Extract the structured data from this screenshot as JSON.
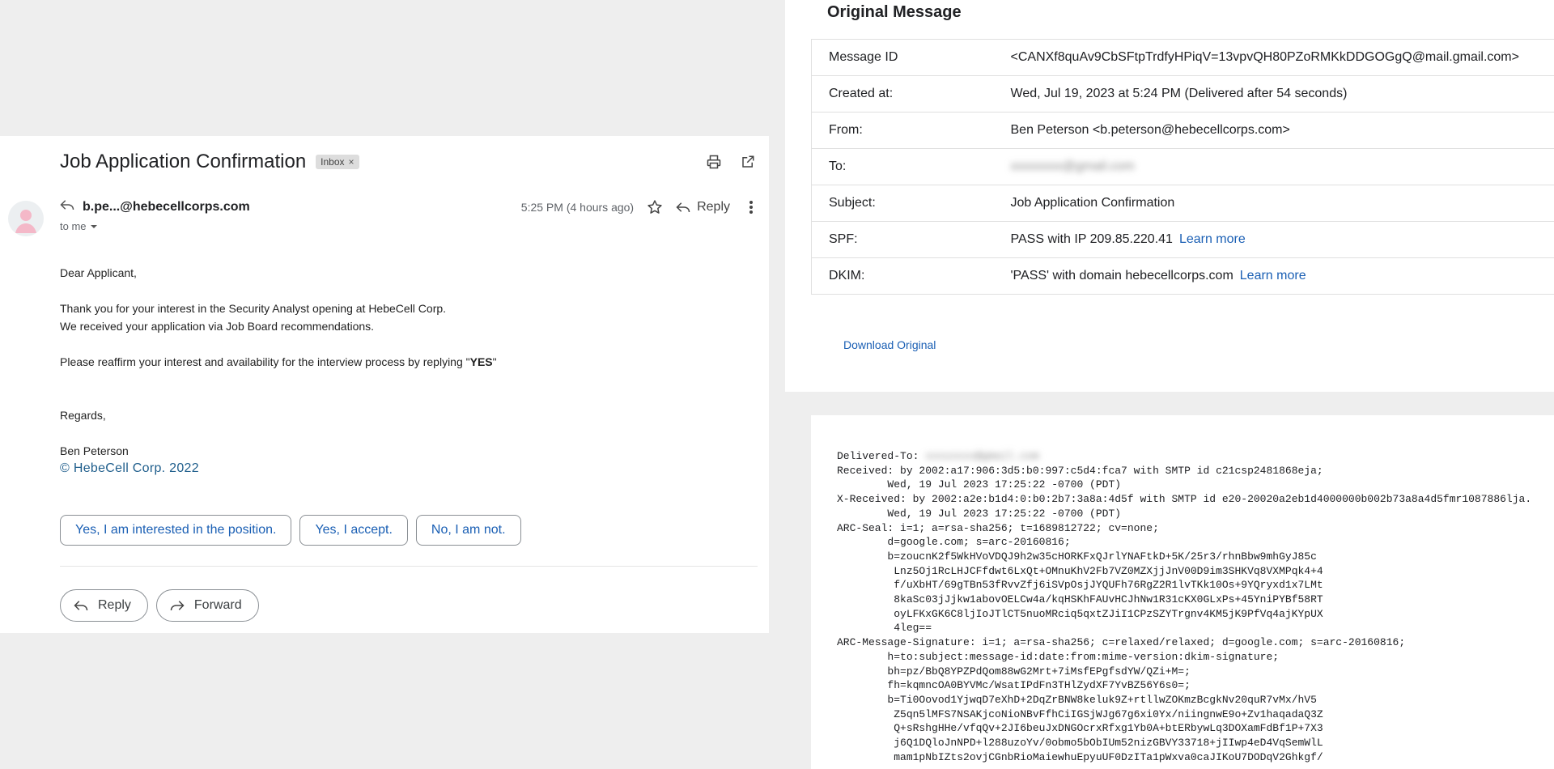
{
  "email": {
    "subject": "Job Application Confirmation",
    "label_chip": "Inbox",
    "label_chip_close": "×",
    "sender": "b.pe...@hebecellcorps.com",
    "to": "to me",
    "time": "5:25 PM (4 hours ago)",
    "reply_label": "Reply",
    "body": {
      "greeting": "Dear Applicant,",
      "line1": "Thank you for your interest in the Security Analyst opening at HebeCell Corp.",
      "line2": "We received your application via Job Board recommendations.",
      "line3_prefix": "Please reaffirm your interest and availability for the interview process by replying \"",
      "line3_bold": "YES",
      "line3_suffix": "\"",
      "regards": "Regards,",
      "signature_name": "Ben Peterson",
      "signature_copyright": "© HebeCell Corp. 2022"
    },
    "smart_replies": [
      "Yes, I am interested in the position.",
      "Yes, I accept.",
      "No, I am not."
    ],
    "actions": {
      "reply": "Reply",
      "forward": "Forward"
    }
  },
  "original": {
    "title": "Original Message",
    "rows": [
      {
        "label": "Message ID",
        "value": "<CANXf8quAv9CbSFtpTrdfyHPiqV=13vpvQH80PZoRMKkDDGOGgQ@mail.gmail.com>"
      },
      {
        "label": "Created at:",
        "value": "Wed, Jul 19, 2023 at 5:24 PM (Delivered after 54 seconds)"
      },
      {
        "label": "From:",
        "value": "Ben Peterson <b.peterson@hebecellcorps.com>"
      },
      {
        "label": "To:",
        "value": "xxxxxxxx@gmail.com"
      },
      {
        "label": "Subject:",
        "value": "Job Application Confirmation"
      },
      {
        "label": "SPF:",
        "value": "PASS with IP 209.85.220.41",
        "link": "Learn more"
      },
      {
        "label": "DKIM:",
        "value": "'PASS' with domain hebecellcorps.com",
        "link": "Learn more"
      }
    ],
    "download": "Download Original"
  },
  "raw_headers": {
    "delivered_to_label": "Delivered-To: ",
    "delivered_to_value": "xxxxxxxx@gmail.com",
    "lines": [
      "Received: by 2002:a17:906:3d5:b0:997:c5d4:fca7 with SMTP id c21csp2481868eja;",
      "        Wed, 19 Jul 2023 17:25:22 -0700 (PDT)",
      "X-Received: by 2002:a2e:b1d4:0:b0:2b7:3a8a:4d5f with SMTP id e20-20020a2eb1d4000000b002b73a8a4d5fmr1087886lja.",
      "        Wed, 19 Jul 2023 17:25:22 -0700 (PDT)",
      "ARC-Seal: i=1; a=rsa-sha256; t=1689812722; cv=none;",
      "        d=google.com; s=arc-20160816;",
      "        b=zoucnK2f5WkHVoVDQJ9h2w35cHORKFxQJrlYNAFtkD+5K/25r3/rhnBbw9mhGyJ85c",
      "         Lnz5Oj1RcLHJCFfdwt6LxQt+OMnuKhV2Fb7VZ0MZXjjJnV00D9im3SHKVq8VXMPqk4+4",
      "         f/uXbHT/69gTBn53fRvvZfj6iSVpOsjJYQUFh76RgZ2R1lvTKk10Os+9YQryxd1x7LMt",
      "         8kaSc03jJjkw1abovOELCw4a/kqHSKhFAUvHCJhNw1R31cKX0GLxPs+45YniPYBf58RT",
      "         oyLFKxGK6C8ljIoJTlCT5nuoMRciq5qxtZJiI1CPzSZYTrgnv4KM5jK9PfVq4ajKYpUX",
      "         4leg==",
      "ARC-Message-Signature: i=1; a=rsa-sha256; c=relaxed/relaxed; d=google.com; s=arc-20160816;",
      "        h=to:subject:message-id:date:from:mime-version:dkim-signature;",
      "        bh=pz/BbQ8YPZPdQom88wG2Mrt+7iMsfEPgfsdYW/QZi+M=;",
      "        fh=kqmncOA0BYVMc/WsatIPdFn3THlZydXF7YvBZ56Y6s0=;",
      "        b=Ti0Oovod1YjwqD7eXhD+2DqZrBNW8keluk9Z+rtllwZOKmzBcgkNv20quR7vMx/hV5",
      "         Z5qn5lMFS7NSAKjcoNioNBvFfhCiIGSjWJg67g6xi0Yx/niingnwE9o+Zv1haqadaQ3Z",
      "         Q+sRshgHHe/vfqQv+2JI6beuJxDNGOcrxRfxg1Yb0A+btERbywLq3DOXamFdBf1P+7X3",
      "         j6Q1DQloJnNPD+l288uzoYv/0obmo5bObIUm52nizGBVY33718+jIIwp4eD4VqSemWlL",
      "         mam1pNbIZts2ovjCGnbRioMaiewhuEpyuUF0DzITa1pWxva0caJIKoU7DODqV2Ghkgf/"
    ]
  }
}
